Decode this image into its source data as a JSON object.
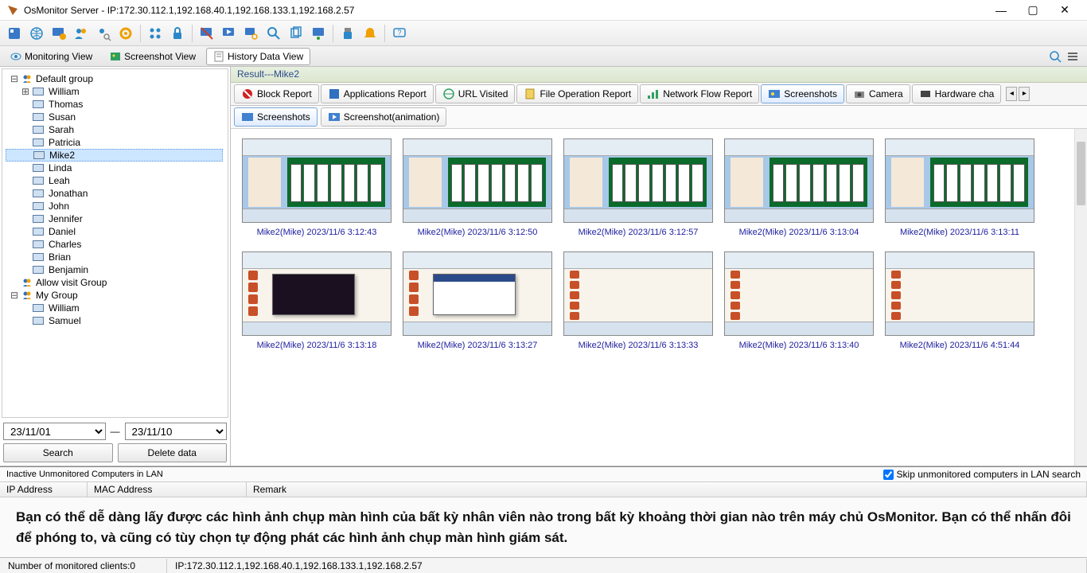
{
  "window": {
    "title": "OsMonitor Server -   IP:172.30.112.1,192.168.40.1,192.168.133.1,192.168.2.57"
  },
  "viewtabs": {
    "monitoring": "Monitoring View",
    "screenshot": "Screenshot View",
    "history": "History Data View"
  },
  "tree": {
    "default_group": "Default group",
    "allow_visit": "Allow visit Group",
    "my_group": "My Group",
    "default_users": [
      "William",
      "Thomas",
      "Susan",
      "Sarah",
      "Patricia",
      "Mike2",
      "Linda",
      "Leah",
      "Jonathan",
      "John",
      "Jennifer",
      "Daniel",
      "Charles",
      "Brian",
      "Benjamin"
    ],
    "my_users": [
      "William",
      "Samuel"
    ],
    "selected": "Mike2"
  },
  "date": {
    "from": "23/11/01",
    "to": "23/11/10",
    "dash": "—",
    "search": "Search",
    "delete": "Delete data"
  },
  "resultbar": "Result---Mike2",
  "reporttabs": {
    "block": "Block Report",
    "apps": "Applications Report",
    "url": "URL Visited",
    "fileop": "File Operation Report",
    "netflow": "Network Flow Report",
    "screenshots": "Screenshots",
    "camera": "Camera",
    "hardware": "Hardware cha"
  },
  "subtabs": {
    "screenshots": "Screenshots",
    "animation": "Screenshot(animation)"
  },
  "thumbs": [
    {
      "label": "Mike2(Mike) 2023/11/6 3:12:43",
      "kind": "solitaire"
    },
    {
      "label": "Mike2(Mike) 2023/11/6 3:12:50",
      "kind": "solitaire"
    },
    {
      "label": "Mike2(Mike) 2023/11/6 3:12:57",
      "kind": "solitaire"
    },
    {
      "label": "Mike2(Mike) 2023/11/6 3:13:04",
      "kind": "solitaire"
    },
    {
      "label": "Mike2(Mike) 2023/11/6 3:13:11",
      "kind": "solitaire"
    },
    {
      "label": "Mike2(Mike) 2023/11/6 3:13:18",
      "kind": "dlg-dark"
    },
    {
      "label": "Mike2(Mike) 2023/11/6 3:13:27",
      "kind": "dlg"
    },
    {
      "label": "Mike2(Mike) 2023/11/6 3:13:33",
      "kind": "desktop"
    },
    {
      "label": "Mike2(Mike) 2023/11/6 3:13:40",
      "kind": "desktop"
    },
    {
      "label": "Mike2(Mike) 2023/11/6 4:51:44",
      "kind": "desktop"
    }
  ],
  "unmon": {
    "title": "Inactive Unmonitored Computers in LAN",
    "skip": "Skip unmonitored computers in LAN search",
    "col_ip": "IP Address",
    "col_mac": "MAC Address",
    "col_remark": "Remark"
  },
  "info_text": "Bạn có thể dễ dàng lấy được các hình ảnh chụp màn hình của bất kỳ nhân viên nào trong bất kỳ khoảng thời gian nào trên máy chủ OsMonitor. Bạn có thể nhấn đôi để phóng to, và cũng có tùy chọn tự động phát các hình ảnh chụp màn hình giám sát.",
  "status": {
    "clients": "Number of monitored clients:0",
    "ip": "IP:172.30.112.1,192.168.40.1,192.168.133.1,192.168.2.57"
  }
}
